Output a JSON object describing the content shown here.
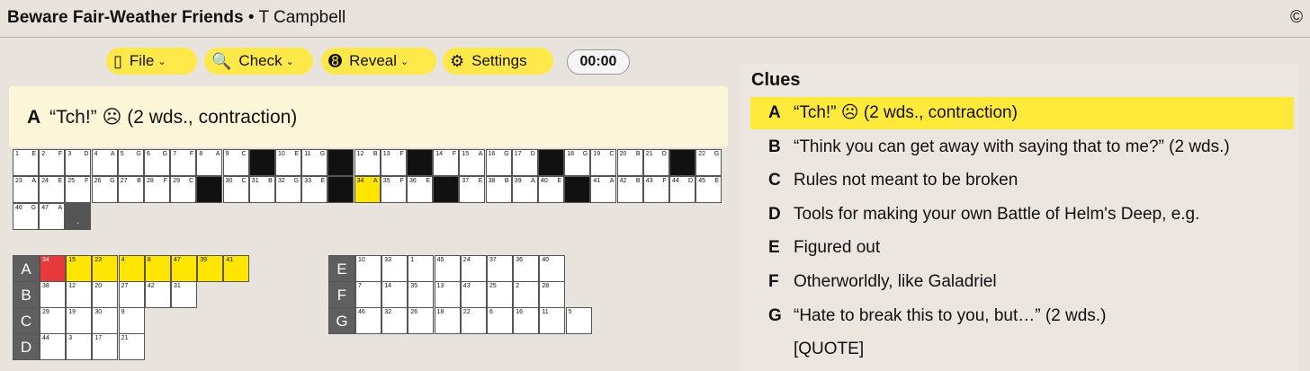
{
  "header": {
    "title": "Beware Fair-Weather Friends",
    "author": "• T Campbell",
    "copyright": "©"
  },
  "toolbar": {
    "file": "File",
    "check": "Check",
    "reveal": "Reveal",
    "settings": "Settings",
    "timer": "00:00"
  },
  "current_clue": {
    "letter": "A",
    "text": "“Tch!” ☹ (2 wds., contraction)"
  },
  "clues_panel": {
    "heading": "Clues",
    "items": [
      {
        "letter": "A",
        "text": "“Tch!” ☹ (2 wds., contraction)"
      },
      {
        "letter": "B",
        "text": "“Think you can get away with saying that to me?” (2 wds.)"
      },
      {
        "letter": "C",
        "text": "Rules not meant to be broken"
      },
      {
        "letter": "D",
        "text": "Tools for making your own Battle of Helm's Deep, e.g."
      },
      {
        "letter": "E",
        "text": "Figured out"
      },
      {
        "letter": "F",
        "text": "Otherworldly, like Galadriel"
      },
      {
        "letter": "G",
        "text": "“Hate to break this to you, but…” (2 wds.)"
      },
      {
        "letter": "",
        "text": "[QUOTE]"
      }
    ]
  },
  "grid_rows": [
    [
      [
        "1",
        "E"
      ],
      [
        "2",
        "F"
      ],
      [
        "3",
        "D"
      ],
      [
        "4",
        "A"
      ],
      [
        "5",
        "G"
      ],
      [
        "6",
        "G"
      ],
      [
        "7",
        "F"
      ],
      [
        "8",
        "A"
      ],
      [
        "9",
        "C"
      ],
      [
        "#",
        ""
      ],
      [
        "10",
        "E"
      ],
      [
        "11",
        "G"
      ],
      [
        "#",
        ""
      ],
      [
        "12",
        "B"
      ],
      [
        "13",
        "F"
      ],
      [
        "#",
        ""
      ],
      [
        "14",
        "F"
      ],
      [
        "15",
        "A"
      ],
      [
        "16",
        "G"
      ],
      [
        "17",
        "D"
      ],
      [
        "#",
        ""
      ],
      [
        "18",
        "G"
      ],
      [
        "19",
        "C"
      ],
      [
        "20",
        "B"
      ],
      [
        "21",
        "D"
      ],
      [
        "#",
        ""
      ],
      [
        "22",
        "G"
      ]
    ],
    [
      [
        "23",
        "A"
      ],
      [
        "24",
        "E"
      ],
      [
        "25",
        "F"
      ],
      [
        "26",
        "G"
      ],
      [
        "27",
        "B"
      ],
      [
        "28",
        "F"
      ],
      [
        "29",
        "C"
      ],
      [
        "#",
        ""
      ],
      [
        "30",
        "C"
      ],
      [
        "31",
        "B"
      ],
      [
        "32",
        "G"
      ],
      [
        "33",
        "E"
      ],
      [
        "#",
        ""
      ],
      [
        "34",
        "A"
      ],
      [
        "35",
        "F"
      ],
      [
        "36",
        "E"
      ],
      [
        "#",
        ""
      ],
      [
        "37",
        "E"
      ],
      [
        "38",
        "B"
      ],
      [
        "39",
        "A"
      ],
      [
        "40",
        "E"
      ],
      [
        "#",
        ""
      ],
      [
        "41",
        "A"
      ],
      [
        "42",
        "B"
      ],
      [
        "43",
        "F"
      ],
      [
        "44",
        "D"
      ],
      [
        "45",
        "E"
      ]
    ],
    [
      [
        "46",
        "G"
      ],
      [
        "47",
        "A"
      ],
      [
        ".",
        ""
      ]
    ]
  ],
  "answer_rows_left": [
    {
      "label": "A",
      "cells": [
        "34",
        "15",
        "23",
        "4",
        "8",
        "47",
        "39",
        "41"
      ]
    },
    {
      "label": "B",
      "cells": [
        "38",
        "12",
        "20",
        "27",
        "42",
        "31"
      ]
    },
    {
      "label": "C",
      "cells": [
        "29",
        "19",
        "30",
        "9"
      ]
    },
    {
      "label": "D",
      "cells": [
        "44",
        "3",
        "17",
        "21"
      ]
    }
  ],
  "answer_rows_right": [
    {
      "label": "E",
      "cells": [
        "10",
        "33",
        "1",
        "45",
        "24",
        "37",
        "36",
        "40"
      ]
    },
    {
      "label": "F",
      "cells": [
        "7",
        "14",
        "35",
        "13",
        "43",
        "25",
        "2",
        "28"
      ]
    },
    {
      "label": "G",
      "cells": [
        "46",
        "32",
        "26",
        "18",
        "22",
        "6",
        "16",
        "11",
        "5"
      ]
    }
  ],
  "colors": {
    "highlight": "#ffe500",
    "selected": "#e83a3a",
    "block": "#111111"
  }
}
